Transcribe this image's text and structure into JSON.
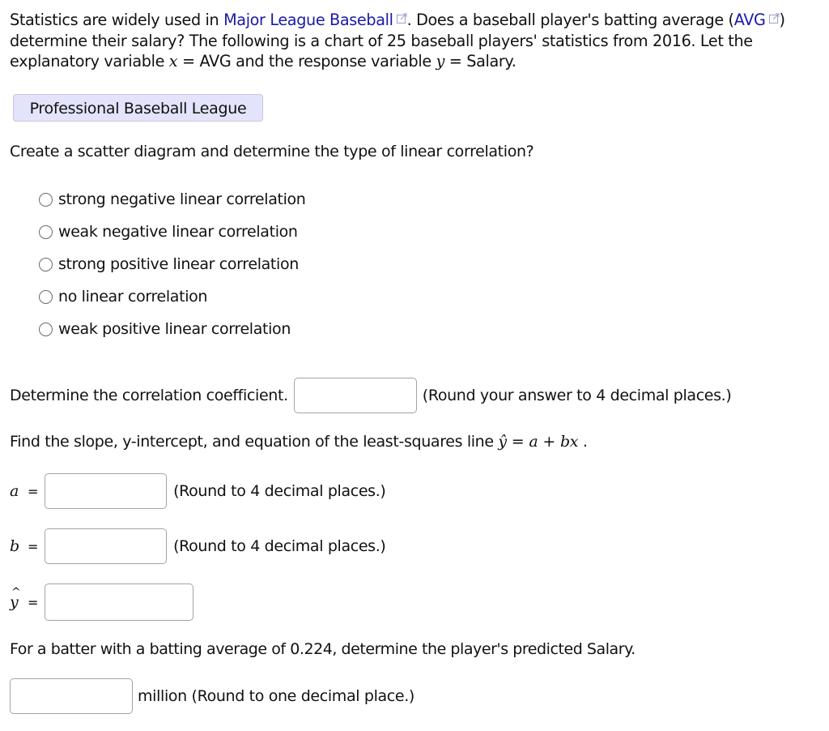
{
  "intro": {
    "part1": "Statistics are widely used in ",
    "link_mlb": "Major League Baseball",
    "part2": ". Does a baseball player's batting average (",
    "link_avg": "AVG",
    "part3": ")",
    "line2": "determine their salary? The following is a chart of 25 baseball players' statistics from 2016. Let the",
    "line3_a": "explanatory variable ",
    "var_x": "x",
    "line3_b": "= AVG and the response variable ",
    "var_y": "y",
    "line3_c": "= Salary."
  },
  "data_button": {
    "label": "Professional Baseball League"
  },
  "question1": {
    "prompt": "Create a scatter diagram and determine the type of linear correlation?",
    "options": [
      {
        "label": "strong negative linear correlation",
        "selected": false
      },
      {
        "label": "weak negative linear correlation",
        "selected": false
      },
      {
        "label": "strong positive linear correlation",
        "selected": false
      },
      {
        "label": "no linear correlation",
        "selected": false
      },
      {
        "label": "weak positive linear correlation",
        "selected": false
      }
    ]
  },
  "correlation": {
    "prompt": "Determine the correlation coefficient.",
    "value": "",
    "hint": "(Round your answer to 4 decimal places.)"
  },
  "least_squares": {
    "prompt": "Find the slope, y-intercept, and equation of the least-squares line ",
    "eq_yhat": "ŷ",
    "eq_equals": "=",
    "eq_a": "a",
    "eq_plus": "+",
    "eq_bx": "bx",
    "eq_end": "."
  },
  "a_field": {
    "label": "a",
    "equals": "=",
    "value": "",
    "hint": "(Round to 4 decimal places.)"
  },
  "b_field": {
    "label": "b",
    "equals": "=",
    "value": "",
    "hint": "(Round to 4 decimal places.)"
  },
  "yhat_field": {
    "label": "y",
    "hat": "^",
    "equals": "=",
    "value": ""
  },
  "prediction": {
    "prompt": "For a batter with a batting average of 0.224, determine the player's predicted Salary.",
    "value": "",
    "unit_hint": "million (Round to one decimal place.)"
  },
  "icons": {
    "external_link": "external-link-icon"
  },
  "colors": {
    "link": "#1a1aa6",
    "button_bg": "#e3e3fb",
    "input_border": "#a3a3a3"
  }
}
